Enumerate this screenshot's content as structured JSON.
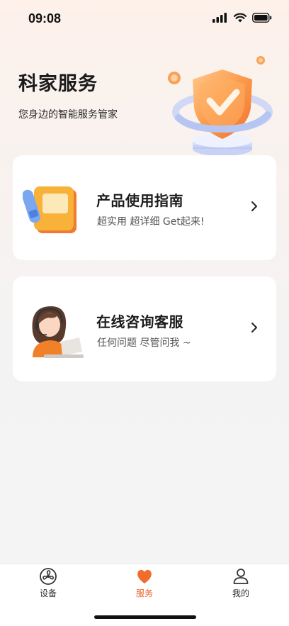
{
  "status_bar": {
    "time": "09:08"
  },
  "header": {
    "title": "科家服务",
    "subtitle": "您身边的智能服务管家"
  },
  "cards": [
    {
      "title": "产品使用指南",
      "subtitle": "超实用 超详细 Get起来!"
    },
    {
      "title": "在线咨询客服",
      "subtitle": "任何问题 尽管问我 ~"
    }
  ],
  "tabbar": {
    "items": [
      {
        "label": "设备",
        "icon": "fan-icon",
        "active": false
      },
      {
        "label": "服务",
        "icon": "heart-icon",
        "active": true
      },
      {
        "label": "我的",
        "icon": "user-icon",
        "active": false
      }
    ]
  },
  "colors": {
    "accent": "#f06d2b",
    "active_tab": "#e9652a",
    "background": "#f4f4f4"
  }
}
